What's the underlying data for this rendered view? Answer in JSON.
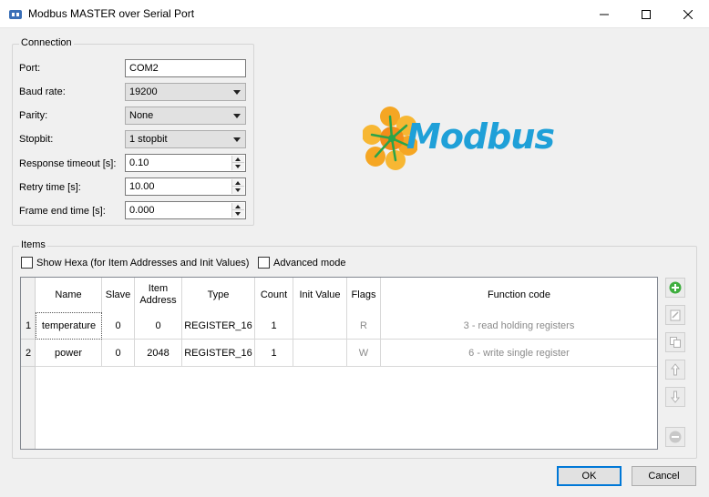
{
  "window": {
    "title": "Modbus MASTER over Serial Port"
  },
  "connection": {
    "group_title": "Connection",
    "fields": {
      "port": {
        "label": "Port:",
        "value": "COM2"
      },
      "baud": {
        "label": "Baud rate:",
        "value": "19200"
      },
      "parity": {
        "label": "Parity:",
        "value": "None"
      },
      "stopbit": {
        "label": "Stopbit:",
        "value": "1 stopbit"
      },
      "timeout": {
        "label": "Response timeout [s]:",
        "value": "0.10"
      },
      "retry": {
        "label": "Retry time [s]:",
        "value": "10.00"
      },
      "frame_end": {
        "label": "Frame end time [s]:",
        "value": "0.000"
      }
    }
  },
  "logo": {
    "text": "Modbus",
    "color": "#1fa0d8",
    "flower_color": "#f5a623"
  },
  "items": {
    "group_title": "Items",
    "show_hexa_label": "Show Hexa (for Item Addresses and Init Values)",
    "advanced_mode_label": "Advanced mode",
    "columns": {
      "name": "Name",
      "slave": "Slave",
      "item_address": "Item\nAddress",
      "type": "Type",
      "count": "Count",
      "init_value": "Init Value",
      "flags": "Flags",
      "function_code": "Function code"
    },
    "rows": [
      {
        "num": "1",
        "name": "temperature",
        "slave": "0",
        "address": "0",
        "type": "REGISTER_16",
        "count": "1",
        "init": "",
        "flags": "R",
        "function": "3 - read holding registers"
      },
      {
        "num": "2",
        "name": "power",
        "slave": "0",
        "address": "2048",
        "type": "REGISTER_16",
        "count": "1",
        "init": "",
        "flags": "W",
        "function": "6 - write single register"
      }
    ],
    "side_buttons": [
      "add-icon",
      "edit-icon",
      "copy-icon",
      "move-up-icon",
      "move-down-icon",
      "remove-icon"
    ]
  },
  "buttons": {
    "ok": "OK",
    "cancel": "Cancel"
  }
}
